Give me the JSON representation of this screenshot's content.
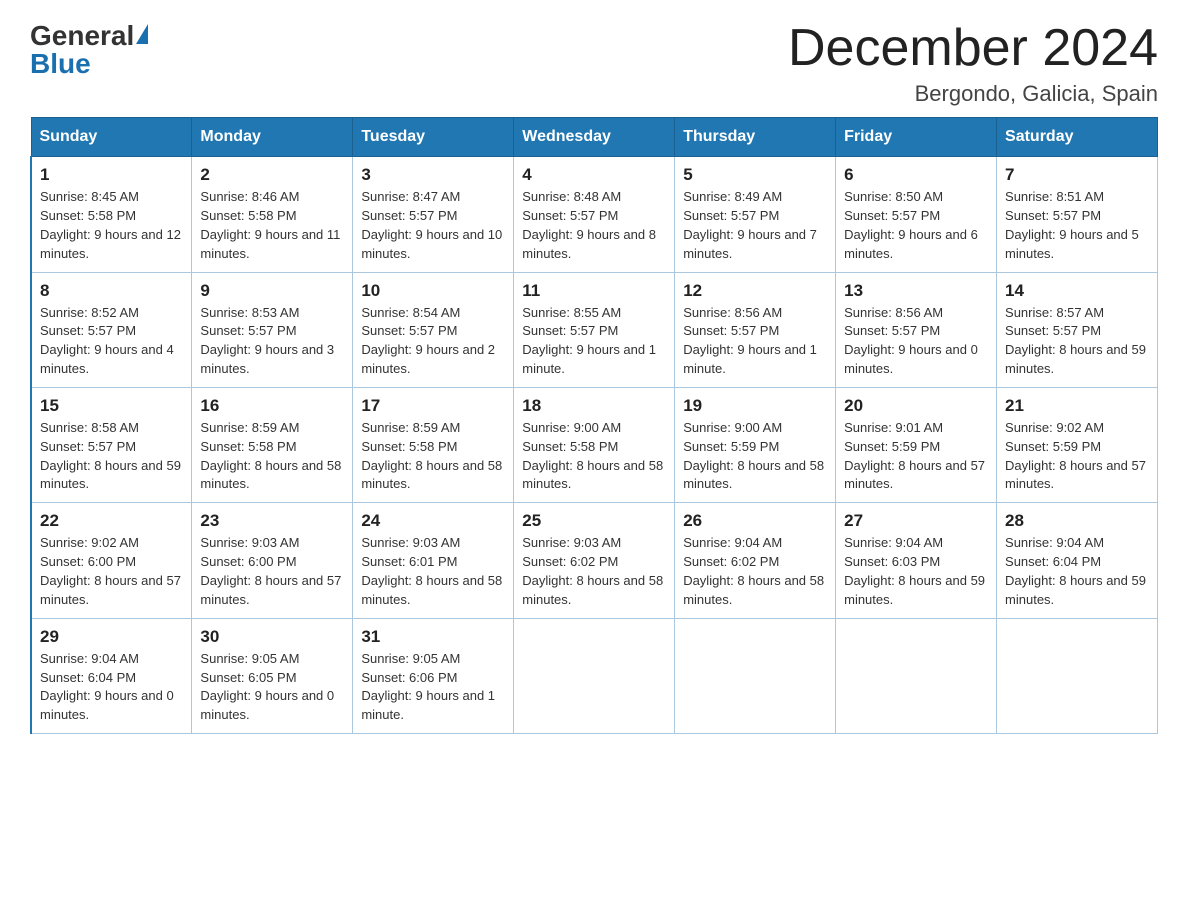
{
  "header": {
    "logo_general": "General",
    "logo_blue": "Blue",
    "month_title": "December 2024",
    "location": "Bergondo, Galicia, Spain"
  },
  "days_of_week": [
    "Sunday",
    "Monday",
    "Tuesday",
    "Wednesday",
    "Thursday",
    "Friday",
    "Saturday"
  ],
  "weeks": [
    [
      {
        "day": "1",
        "sunrise": "8:45 AM",
        "sunset": "5:58 PM",
        "daylight": "9 hours and 12 minutes."
      },
      {
        "day": "2",
        "sunrise": "8:46 AM",
        "sunset": "5:58 PM",
        "daylight": "9 hours and 11 minutes."
      },
      {
        "day": "3",
        "sunrise": "8:47 AM",
        "sunset": "5:57 PM",
        "daylight": "9 hours and 10 minutes."
      },
      {
        "day": "4",
        "sunrise": "8:48 AM",
        "sunset": "5:57 PM",
        "daylight": "9 hours and 8 minutes."
      },
      {
        "day": "5",
        "sunrise": "8:49 AM",
        "sunset": "5:57 PM",
        "daylight": "9 hours and 7 minutes."
      },
      {
        "day": "6",
        "sunrise": "8:50 AM",
        "sunset": "5:57 PM",
        "daylight": "9 hours and 6 minutes."
      },
      {
        "day": "7",
        "sunrise": "8:51 AM",
        "sunset": "5:57 PM",
        "daylight": "9 hours and 5 minutes."
      }
    ],
    [
      {
        "day": "8",
        "sunrise": "8:52 AM",
        "sunset": "5:57 PM",
        "daylight": "9 hours and 4 minutes."
      },
      {
        "day": "9",
        "sunrise": "8:53 AM",
        "sunset": "5:57 PM",
        "daylight": "9 hours and 3 minutes."
      },
      {
        "day": "10",
        "sunrise": "8:54 AM",
        "sunset": "5:57 PM",
        "daylight": "9 hours and 2 minutes."
      },
      {
        "day": "11",
        "sunrise": "8:55 AM",
        "sunset": "5:57 PM",
        "daylight": "9 hours and 1 minute."
      },
      {
        "day": "12",
        "sunrise": "8:56 AM",
        "sunset": "5:57 PM",
        "daylight": "9 hours and 1 minute."
      },
      {
        "day": "13",
        "sunrise": "8:56 AM",
        "sunset": "5:57 PM",
        "daylight": "9 hours and 0 minutes."
      },
      {
        "day": "14",
        "sunrise": "8:57 AM",
        "sunset": "5:57 PM",
        "daylight": "8 hours and 59 minutes."
      }
    ],
    [
      {
        "day": "15",
        "sunrise": "8:58 AM",
        "sunset": "5:57 PM",
        "daylight": "8 hours and 59 minutes."
      },
      {
        "day": "16",
        "sunrise": "8:59 AM",
        "sunset": "5:58 PM",
        "daylight": "8 hours and 58 minutes."
      },
      {
        "day": "17",
        "sunrise": "8:59 AM",
        "sunset": "5:58 PM",
        "daylight": "8 hours and 58 minutes."
      },
      {
        "day": "18",
        "sunrise": "9:00 AM",
        "sunset": "5:58 PM",
        "daylight": "8 hours and 58 minutes."
      },
      {
        "day": "19",
        "sunrise": "9:00 AM",
        "sunset": "5:59 PM",
        "daylight": "8 hours and 58 minutes."
      },
      {
        "day": "20",
        "sunrise": "9:01 AM",
        "sunset": "5:59 PM",
        "daylight": "8 hours and 57 minutes."
      },
      {
        "day": "21",
        "sunrise": "9:02 AM",
        "sunset": "5:59 PM",
        "daylight": "8 hours and 57 minutes."
      }
    ],
    [
      {
        "day": "22",
        "sunrise": "9:02 AM",
        "sunset": "6:00 PM",
        "daylight": "8 hours and 57 minutes."
      },
      {
        "day": "23",
        "sunrise": "9:03 AM",
        "sunset": "6:00 PM",
        "daylight": "8 hours and 57 minutes."
      },
      {
        "day": "24",
        "sunrise": "9:03 AM",
        "sunset": "6:01 PM",
        "daylight": "8 hours and 58 minutes."
      },
      {
        "day": "25",
        "sunrise": "9:03 AM",
        "sunset": "6:02 PM",
        "daylight": "8 hours and 58 minutes."
      },
      {
        "day": "26",
        "sunrise": "9:04 AM",
        "sunset": "6:02 PM",
        "daylight": "8 hours and 58 minutes."
      },
      {
        "day": "27",
        "sunrise": "9:04 AM",
        "sunset": "6:03 PM",
        "daylight": "8 hours and 59 minutes."
      },
      {
        "day": "28",
        "sunrise": "9:04 AM",
        "sunset": "6:04 PM",
        "daylight": "8 hours and 59 minutes."
      }
    ],
    [
      {
        "day": "29",
        "sunrise": "9:04 AM",
        "sunset": "6:04 PM",
        "daylight": "9 hours and 0 minutes."
      },
      {
        "day": "30",
        "sunrise": "9:05 AM",
        "sunset": "6:05 PM",
        "daylight": "9 hours and 0 minutes."
      },
      {
        "day": "31",
        "sunrise": "9:05 AM",
        "sunset": "6:06 PM",
        "daylight": "9 hours and 1 minute."
      },
      null,
      null,
      null,
      null
    ]
  ]
}
